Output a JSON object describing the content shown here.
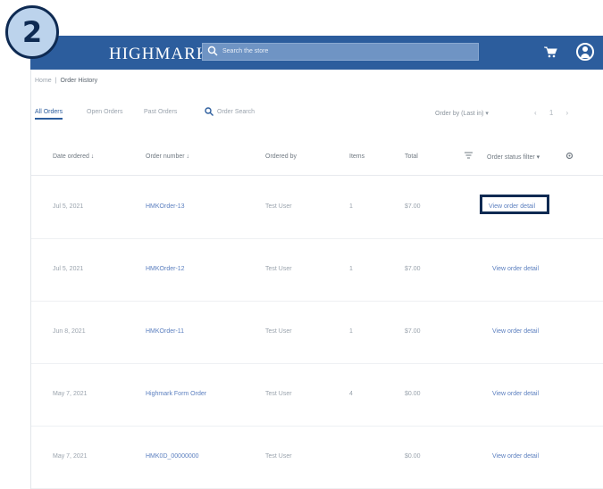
{
  "step_number": "2",
  "header": {
    "logo_text": "HIGHMARK",
    "search_placeholder": "Search the store"
  },
  "breadcrumbs": {
    "home": "Home",
    "current": "Order History"
  },
  "tabs": [
    {
      "label": "All Orders"
    },
    {
      "label": "Open Orders"
    },
    {
      "label": "Past Orders"
    }
  ],
  "order_search": {
    "placeholder": "Order Search"
  },
  "sort": {
    "label": "Order by (Last in) ▾"
  },
  "pager": {
    "text": "‹ 1 ›"
  },
  "columns": {
    "date": "Date ordered ↓",
    "order": "Order number ↓",
    "ordered_by": "Ordered by",
    "items": "Items",
    "total": "Total",
    "status": "Order status filter ▾"
  },
  "rows": [
    {
      "date": "Jul 5, 2021",
      "order": "HMKOrder-13",
      "by": "Test User",
      "items": "1",
      "total": "$7.00",
      "action": "View order detail",
      "highlighted": true
    },
    {
      "date": "Jul 5, 2021",
      "order": "HMKOrder-12",
      "by": "Test User",
      "items": "1",
      "total": "$7.00",
      "action": "View order detail"
    },
    {
      "date": "Jun 8, 2021",
      "order": "HMKOrder-11",
      "by": "Test User",
      "items": "1",
      "total": "$7.00",
      "action": "View order detail"
    },
    {
      "date": "May 7, 2021",
      "order": "Highmark Form Order",
      "by": "Test User",
      "items": "4",
      "total": "$0.00",
      "action": "View order detail"
    },
    {
      "date": "May 7, 2021",
      "order": "HMK0D_00000000",
      "by": "Test User",
      "items": "",
      "total": "$0.00",
      "action": "View order detail"
    }
  ],
  "colors": {
    "brand": "#2c5d9d",
    "highlight": "#0e2a52"
  }
}
